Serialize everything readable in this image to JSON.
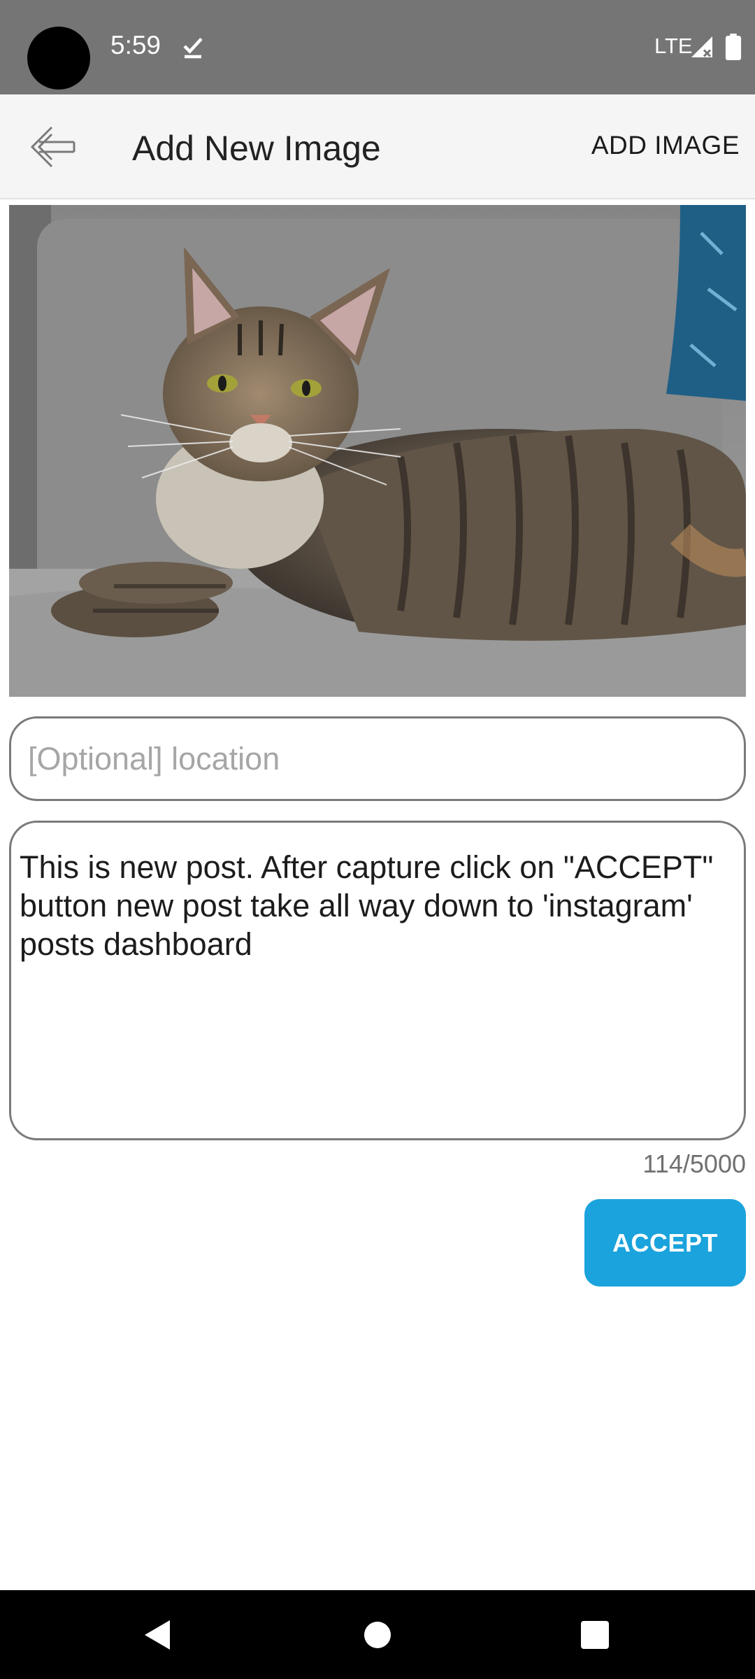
{
  "status_bar": {
    "time": "5:59",
    "network": "LTE",
    "icons": [
      "camera-cutout",
      "check-icon",
      "signal-icon",
      "battery-icon"
    ]
  },
  "app_bar": {
    "title": "Add New Image",
    "action_label": "ADD IMAGE",
    "back_icon": "arrow-back-icon"
  },
  "photo": {
    "subject": "cat-photo"
  },
  "location": {
    "placeholder": "[Optional] location",
    "value": ""
  },
  "caption": {
    "value": "This is new post. After capture click on \"ACCEPT\" button new post take all way down to 'instagram' posts dashboard",
    "counter": "114/5000"
  },
  "accept_button": {
    "label": "ACCEPT"
  },
  "colors": {
    "status_bar": "#757575",
    "app_bar": "#f5f5f5",
    "accent": "#1aa3dc",
    "nav_bar": "#000000"
  },
  "nav": {
    "icons": [
      "nav-back-icon",
      "nav-home-icon",
      "nav-recents-icon"
    ]
  }
}
